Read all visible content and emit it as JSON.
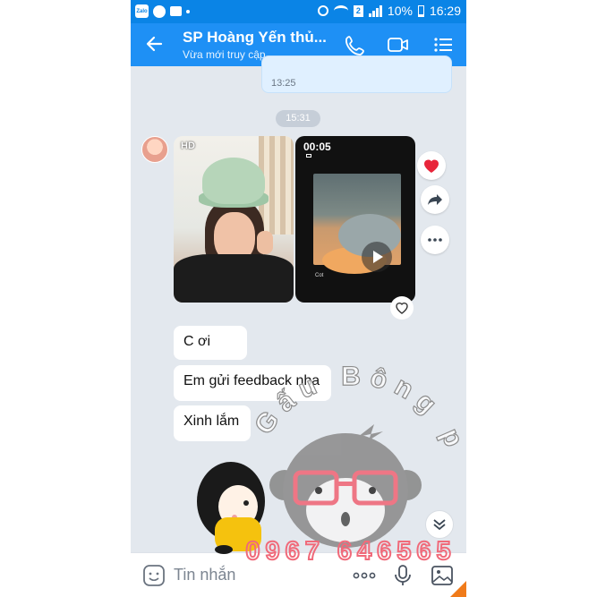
{
  "status_bar": {
    "left_icons": [
      "zalo-icon",
      "messenger-icon",
      "chat-icon",
      "dot-icon"
    ],
    "zalo_text": "Zalo",
    "sim_label": "2",
    "battery": "10%",
    "time": "16:29"
  },
  "header": {
    "title": "SP Hoàng Yến thủ...",
    "subtitle": "Vừa mới truy cập",
    "icons": [
      "back-arrow-icon",
      "phone-call-icon",
      "video-call-icon",
      "menu-list-icon"
    ]
  },
  "messages": {
    "outgoing_time": "13:25",
    "divider_time": "15:31",
    "photo_badge": "HD",
    "video_duration": "00:05",
    "video_caption": "Cot",
    "reaction": "heart-icon",
    "incoming": [
      "C ơi",
      "Em gửi feedback nha",
      "Xinh lắm"
    ]
  },
  "watermark": {
    "arc_text": "Gấu Bông pk",
    "phone": "0967 646565"
  },
  "composer": {
    "placeholder": "Tin nhắn",
    "icons": [
      "sticker-icon",
      "more-dots-icon",
      "microphone-icon",
      "image-icon"
    ]
  },
  "colors": {
    "header_blue": "#1e90f5",
    "status_blue": "#0a84e6",
    "chat_bg": "#e3e8ee",
    "watermark_pink": "#f06a7a"
  }
}
